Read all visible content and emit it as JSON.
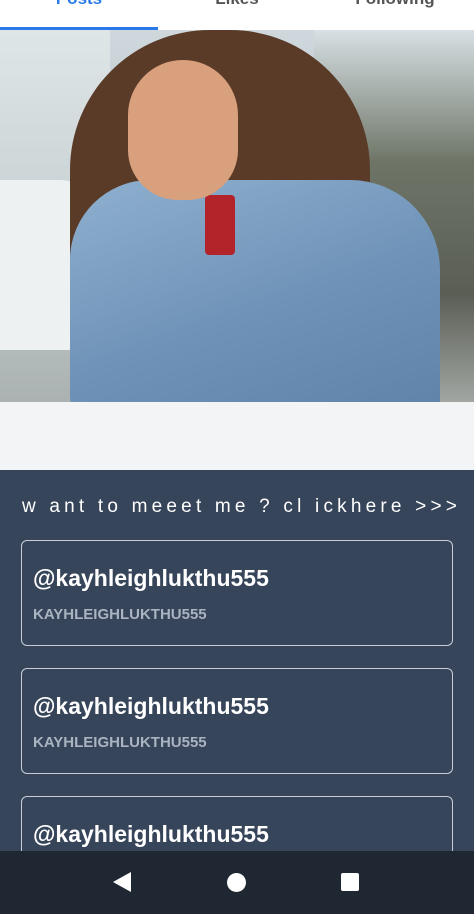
{
  "tabs": [
    {
      "label": "Posts",
      "active": true
    },
    {
      "label": "Likes",
      "active": false
    },
    {
      "label": "Following",
      "active": false
    }
  ],
  "colors": {
    "accent": "#2979e8",
    "background": "#37455a",
    "navbar": "#1f2733"
  },
  "prompt": "w ant to meeet me ? cl ickhere >>>",
  "cards": [
    {
      "handle": "@kayhleighlukthu555",
      "subtitle": "KAYHLEIGHLUKTHU555"
    },
    {
      "handle": "@kayhleighlukthu555",
      "subtitle": "KAYHLEIGHLUKTHU555"
    },
    {
      "handle": "@kayhleighlukthu555",
      "subtitle": ""
    }
  ],
  "navbar": {
    "back_icon": "back-triangle-icon",
    "home_icon": "home-circle-icon",
    "recents_icon": "recents-square-icon"
  }
}
